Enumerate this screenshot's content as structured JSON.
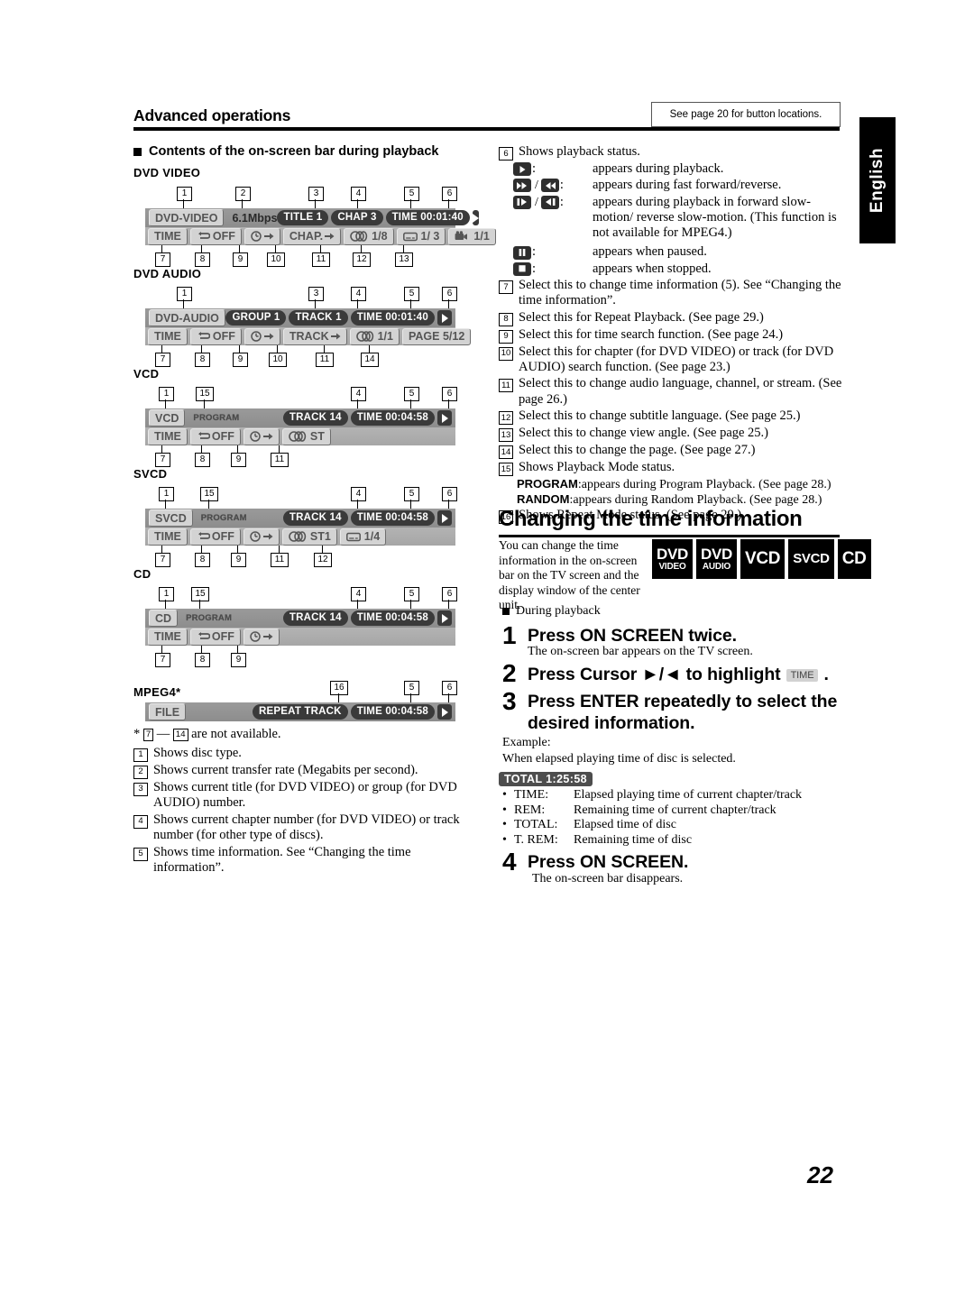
{
  "header": {
    "title": "Advanced operations",
    "button_note": "See page 20 for button locations.",
    "language_tab": "English"
  },
  "section": {
    "heading": "Contents of the on-screen bar during playback"
  },
  "osd_bars": [
    {
      "label": "DVD VIDEO",
      "disc": "DVD-VIDEO",
      "rate": "6.1Mbps",
      "title": "TITLE  1",
      "chapter": "CHAP  3",
      "time": "TIME 00:01:40",
      "row2": [
        "TIME",
        "OFF",
        "",
        "CHAP.",
        "1/8",
        "1/ 3",
        "1/1"
      ]
    },
    {
      "label": "DVD AUDIO",
      "disc": "DVD-AUDIO",
      "group": "GROUP 1",
      "track": "TRACK 1",
      "time": "TIME 00:01:40",
      "row2": [
        "TIME",
        "OFF",
        "",
        "TRACK",
        "1/1",
        "PAGE 5/12"
      ]
    },
    {
      "label": "VCD",
      "disc": "VCD",
      "mode": "PROGRAM",
      "track": "TRACK 14",
      "time": "TIME 00:04:58",
      "row2": [
        "TIME",
        "OFF",
        "",
        "ST"
      ]
    },
    {
      "label": "SVCD",
      "disc": "SVCD",
      "mode": "PROGRAM",
      "track": "TRACK 14",
      "time": "TIME 00:04:58",
      "row2": [
        "TIME",
        "OFF",
        "",
        "ST1",
        "1/4"
      ]
    },
    {
      "label": "CD",
      "disc": "CD",
      "mode": "PROGRAM",
      "track": "TRACK 14",
      "time": "TIME 00:04:58",
      "row2": [
        "TIME",
        "OFF",
        ""
      ]
    },
    {
      "label": "MPEG4*",
      "disc": "FILE",
      "repeat": "REPEAT  TRACK",
      "time": "TIME 00:04:58"
    }
  ],
  "left_notes": {
    "footnote_pre": "*",
    "footnote_a": "7",
    "footnote_dash": "—",
    "footnote_b": "14",
    "footnote_post": "are not available.",
    "items": [
      {
        "n": "1",
        "text": "Shows disc type."
      },
      {
        "n": "2",
        "text": "Shows current transfer rate (Megabits per second)."
      },
      {
        "n": "3",
        "text": "Shows current title (for DVD VIDEO) or group (for DVD AUDIO) number."
      },
      {
        "n": "4",
        "text": "Shows current chapter number (for DVD VIDEO) or track number (for other type of discs)."
      },
      {
        "n": "5",
        "text": "Shows time information. See “Changing the time information”."
      }
    ]
  },
  "right_notes": {
    "item6_head": {
      "n": "6",
      "text": "Shows playback status."
    },
    "status_rows": [
      {
        "glyph": "play",
        "text": "appears during playback."
      },
      {
        "glyph": "ff-rew",
        "text": "appears during fast forward/reverse."
      },
      {
        "glyph": "slow-fwd-rev",
        "text": "appears during playback in forward slow-motion/ reverse slow-motion. (This function is not available for MPEG4.)"
      },
      {
        "glyph": "pause",
        "text": "appears when paused."
      },
      {
        "glyph": "stop",
        "text": "appears when stopped."
      }
    ],
    "items": [
      {
        "n": "7",
        "text": "Select this to change time information (5). See “Changing the time information”."
      },
      {
        "n": "8",
        "text": "Select this for Repeat Playback. (See page 29.)"
      },
      {
        "n": "9",
        "text": "Select this for time search function. (See page 24.)"
      },
      {
        "n": "10",
        "text": "Select this for chapter (for DVD VIDEO) or track (for DVD AUDIO) search function. (See page 23.)"
      },
      {
        "n": "11",
        "text": "Select this to change audio language, channel, or stream. (See page 26.)"
      },
      {
        "n": "12",
        "text": "Select this to change subtitle language. (See page 25.)"
      },
      {
        "n": "13",
        "text": "Select this to change view angle. (See page 25.)"
      },
      {
        "n": "14",
        "text": "Select this to change the page. (See page 27.)"
      },
      {
        "n": "15",
        "text": "Shows Playback Mode status."
      },
      {
        "n": "16",
        "text": "Shows Repeat Mode status. (See page 29.)"
      }
    ],
    "playback_mode": [
      {
        "bold": "PROGRAM",
        "rest": ":appears during Program Playback. (See page 28.)"
      },
      {
        "bold": "RANDOM",
        "rest": ":appears during Random Playback. (See page 28.)"
      }
    ]
  },
  "time_section": {
    "heading": "Changing the time information",
    "intro": "You can change the time information in the on-screen bar on the TV screen and the display window of the center unit.",
    "badges": [
      {
        "line1": "DVD",
        "line2": "VIDEO"
      },
      {
        "line1": "DVD",
        "line2": "AUDIO"
      },
      {
        "line1": "VCD",
        "line2": ""
      },
      {
        "line1": "SVCD",
        "line2": ""
      },
      {
        "line1": "CD",
        "line2": ""
      }
    ],
    "during_playback": "During playback",
    "steps": [
      {
        "num": "1",
        "text": "Press ON SCREEN twice.",
        "sub": "The on-screen bar appears on the TV screen."
      },
      {
        "num": "2",
        "text_a": "Press Cursor ►/◄ to highlight",
        "chip": "TIME",
        "text_b": "."
      },
      {
        "num": "3",
        "text": "Press ENTER repeatedly to select the desired information."
      },
      {
        "num": "4",
        "text": "Press ON SCREEN.",
        "sub": "The on-screen bar disappears."
      }
    ],
    "example_label": "Example:",
    "example_text": "When elapsed playing time of disc is selected.",
    "total_chip": "TOTAL  1:25:58",
    "legend": [
      {
        "label": "TIME:",
        "value": "Elapsed playing time of current chapter/track"
      },
      {
        "label": "REM:",
        "value": "Remaining time of current chapter/track"
      },
      {
        "label": "TOTAL:",
        "value": "Elapsed time of disc"
      },
      {
        "label": "T. REM:",
        "value": "Remaining time of disc"
      }
    ]
  },
  "page_number": "22"
}
